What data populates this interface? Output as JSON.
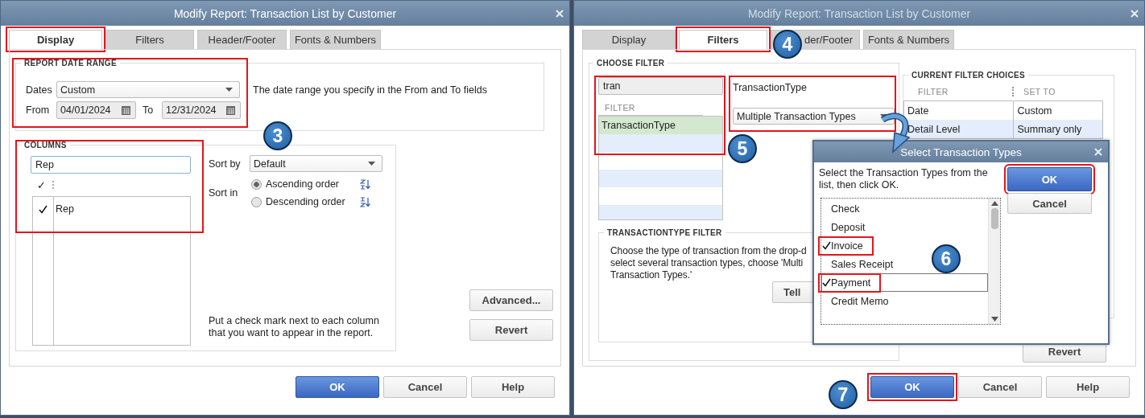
{
  "left": {
    "title": "Modify Report: Transaction List by Customer",
    "active": true,
    "tabs": [
      {
        "label": "Display",
        "selected": true,
        "highlighted": true
      },
      {
        "label": "Filters",
        "selected": false,
        "highlighted": false
      },
      {
        "label": "Header/Footer",
        "selected": false,
        "highlighted": false
      },
      {
        "label": "Fonts & Numbers",
        "selected": false,
        "highlighted": false
      }
    ],
    "date_range": {
      "legend": "REPORT DATE RANGE",
      "highlighted": true,
      "dates_label": "Dates",
      "dates_value": "Custom",
      "description": "The date range you specify in the From and To fields",
      "from_label": "From",
      "from_value": "04/01/2024",
      "to_label": "To",
      "to_value": "12/31/2024"
    },
    "step_badge": "3",
    "columns": {
      "legend": "COLUMNS",
      "highlighted": true,
      "search_value": "Rep",
      "header_mark": "✓",
      "rows": [
        {
          "label": "Rep",
          "checked": true
        }
      ],
      "sort_by_label": "Sort by",
      "sort_by_value": "Default",
      "sort_in_label": "Sort in",
      "orders": [
        {
          "label": "Ascending order",
          "selected": true,
          "kind": "ascending"
        },
        {
          "label": "Descending order",
          "selected": false,
          "kind": "descending"
        }
      ],
      "hint": "Put a check mark next to each column that you want to appear in the report."
    },
    "side_buttons": [
      "Advanced...",
      "Revert"
    ],
    "buttons": [
      {
        "label": "OK",
        "primary": true
      },
      {
        "label": "Cancel",
        "primary": false
      },
      {
        "label": "Help",
        "primary": false
      }
    ]
  },
  "right": {
    "title": "Modify Report: Transaction List by Customer",
    "active": false,
    "tabs": [
      {
        "label": "Display",
        "selected": false,
        "highlighted": false
      },
      {
        "label": "Filters",
        "selected": true,
        "highlighted": true
      },
      {
        "label": "der/Footer",
        "selected": false,
        "highlighted": false
      },
      {
        "label": "Fonts & Numbers",
        "selected": false,
        "highlighted": false
      }
    ],
    "tab_badge": "4",
    "choose_filter": {
      "legend": "CHOOSE FILTER",
      "search_value": "tran",
      "search_highlighted": true,
      "list_header": "FILTER",
      "items": [
        {
          "label": "TransactionType",
          "selected": true
        }
      ],
      "step_badge": "5",
      "selector_highlighted": true,
      "selector_label": "TransactionType",
      "selector_value": "Multiple Transaction Types",
      "detail": {
        "legend": "TRANSACTIONTYPE FILTER",
        "lines": [
          "Choose the type of transaction from the drop-d",
          "select several transaction types, choose 'Multi",
          "Transaction Types.'"
        ],
        "button": "Tell"
      }
    },
    "current": {
      "legend": "CURRENT FILTER CHOICES",
      "columns": [
        "FILTER",
        "SET TO"
      ],
      "rows": [
        {
          "filter": "Date",
          "set_to": "Custom"
        },
        {
          "filter": "Detail Level",
          "set_to": "Summary only"
        }
      ]
    },
    "side_button": "Revert",
    "buttons": [
      {
        "label": "OK",
        "primary": true,
        "highlighted": true
      },
      {
        "label": "Cancel",
        "primary": false
      },
      {
        "label": "Help",
        "primary": false
      }
    ],
    "step_badge": "7",
    "popup": {
      "title": "Select Transaction Types",
      "instructions": "Select the Transaction Types from the list, then click OK.",
      "buttons": [
        {
          "label": "OK",
          "primary": true,
          "highlighted": true
        },
        {
          "label": "Cancel",
          "primary": false,
          "highlighted": false
        }
      ],
      "items": [
        {
          "label": "Check",
          "checked": false,
          "focused": false,
          "highlighted": false
        },
        {
          "label": "Deposit",
          "checked": false,
          "focused": false,
          "highlighted": false
        },
        {
          "label": "Invoice",
          "checked": true,
          "focused": false,
          "highlighted": true
        },
        {
          "label": "Sales Receipt",
          "checked": false,
          "focused": false,
          "highlighted": false
        },
        {
          "label": "Payment",
          "checked": true,
          "focused": true,
          "highlighted": true
        },
        {
          "label": "Credit Memo",
          "checked": false,
          "focused": false,
          "highlighted": false
        }
      ],
      "step_badge": "6"
    }
  }
}
